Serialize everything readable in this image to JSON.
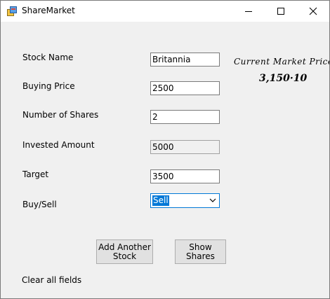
{
  "window": {
    "title": "ShareMarket",
    "icon": "app-window-icon",
    "controls": [
      "minimize-icon",
      "maximize-icon",
      "close-icon"
    ]
  },
  "form": {
    "stock_name": {
      "label": "Stock Name",
      "value": "Britannia"
    },
    "buying_price": {
      "label": "Buying Price",
      "value": "2500"
    },
    "number_of_shares": {
      "label": "Number of Shares",
      "value": "2"
    },
    "invested_amount": {
      "label": "Invested Amount",
      "value": "5000"
    },
    "target": {
      "label": "Target",
      "value": "3500"
    },
    "buy_sell": {
      "label": "Buy/Sell",
      "selected": "Sell"
    }
  },
  "market": {
    "label": "Current Market Price",
    "value": "3,150·10"
  },
  "buttons": {
    "add_line1": "Add Another",
    "add_line2": "Stock",
    "show_line1": "Show",
    "show_line2": "Shares"
  },
  "clear_label": "Clear all fields",
  "colors": {
    "window_bg": "#f0f0f0",
    "titlebar_bg": "#ffffff",
    "selection": "#0078d7",
    "button_bg": "#e1e1e1"
  }
}
